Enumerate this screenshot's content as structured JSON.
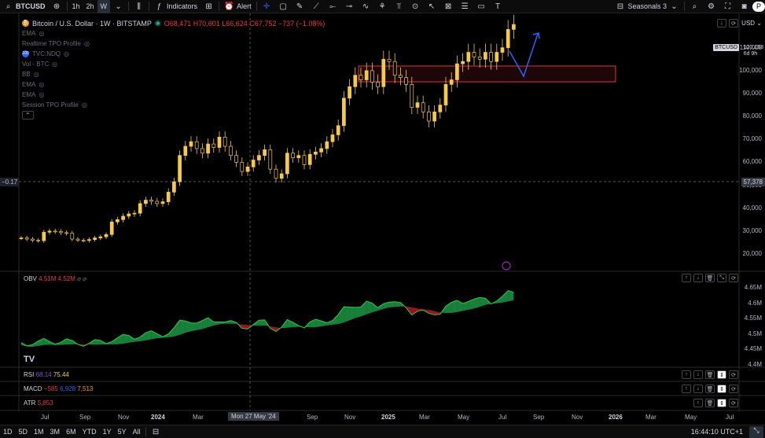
{
  "toolbar": {
    "symbol": "BTCUSD",
    "timeframes": [
      "1h",
      "2h",
      "W"
    ],
    "indicators_label": "Indicators",
    "alert_label": "Alert",
    "seasonals_label": "Seasonals 3",
    "right_letter": "P"
  },
  "legend": {
    "title": "Bitcoin / U.S. Dollar · 1W · BITSTAMP",
    "ohlc": "O68,471 H70,601 L66,624 C67,752 −737 (−1.08%)",
    "items": [
      "EMA",
      "Realtime TPO Profile",
      "TVC:NDQ",
      "Vol · BTC",
      "BB",
      "EMA",
      "EMA",
      "Session TPO Profile"
    ],
    "tvc_badge": "100"
  },
  "price_axis": {
    "labels": [
      "110,000",
      "100,000",
      "90,000",
      "80,000",
      "70,000",
      "60,000",
      "50,000",
      "40,000",
      "30,000",
      "20,000"
    ],
    "symbol_badge": "BTCUSD",
    "current_price": "120,168",
    "countdown": "6d 9h",
    "cursor_price": "57,378",
    "left_value": "−0.17"
  },
  "obv": {
    "name": "OBV",
    "values": "4.51M 4.52M",
    "axis": [
      "4.65M",
      "4.6M",
      "4.55M",
      "4.5M",
      "4.45M",
      "4.4M"
    ]
  },
  "rsi": {
    "name": "RSI",
    "v1": "68.14",
    "v2": "75.44"
  },
  "macd": {
    "name": "MACD",
    "v1": "−585",
    "v2": "6,928",
    "v3": "7,513"
  },
  "atr": {
    "name": "ATR",
    "v1": "5,853"
  },
  "time_axis": {
    "labels": [
      {
        "t": "Jul",
        "x": 52,
        "b": false
      },
      {
        "t": "Sep",
        "x": 101,
        "b": false
      },
      {
        "t": "Nov",
        "x": 150,
        "b": false
      },
      {
        "t": "2024",
        "x": 192,
        "b": true
      },
      {
        "t": "Mar",
        "x": 245,
        "b": false
      },
      {
        "t": "Sep",
        "x": 390,
        "b": false
      },
      {
        "t": "Nov",
        "x": 438,
        "b": false
      },
      {
        "t": "2025",
        "x": 485,
        "b": true
      },
      {
        "t": "Mar",
        "x": 533,
        "b": false
      },
      {
        "t": "May",
        "x": 582,
        "b": false
      },
      {
        "t": "Jul",
        "x": 634,
        "b": false
      },
      {
        "t": "Sep",
        "x": 678,
        "b": false
      },
      {
        "t": "Nov",
        "x": 727,
        "b": false
      },
      {
        "t": "2026",
        "x": 774,
        "b": true
      },
      {
        "t": "Mar",
        "x": 821,
        "b": false
      },
      {
        "t": "May",
        "x": 871,
        "b": false
      },
      {
        "t": "Jul",
        "x": 923,
        "b": false
      }
    ],
    "cursor_date": "Mon 27 May '24"
  },
  "bottom": {
    "ranges": [
      "1D",
      "5D",
      "1M",
      "3M",
      "6M",
      "YTD",
      "1Y",
      "5Y",
      "All"
    ],
    "clock": "16:44:10 UTC+1"
  },
  "chart_data": {
    "type": "candlestick",
    "series_name": "BTCUSD",
    "approx_weekly_closes": [
      27000,
      26500,
      26000,
      25800,
      29500,
      30000,
      29800,
      29300,
      29100,
      26500,
      26000,
      25900,
      26300,
      27000,
      27500,
      28500,
      34000,
      35000,
      36500,
      37500,
      37800,
      42000,
      43500,
      43000,
      42000,
      42800,
      47000,
      51500,
      63000,
      67000,
      69000,
      66000,
      64000,
      68000,
      66500,
      71000,
      67000,
      63000,
      60000,
      56000,
      58000,
      61000,
      63000,
      65500,
      57000,
      53000,
      55000,
      64000,
      62000,
      63000,
      59000,
      63500,
      64500,
      66000,
      69000,
      72000,
      76000,
      88000,
      93000,
      98000,
      96000,
      100000,
      95000,
      93000,
      105000,
      104000,
      98000,
      97000,
      94000,
      84000,
      86000,
      82000,
      78000,
      82000,
      85000,
      94000,
      96000,
      103000,
      104000,
      108000,
      106000,
      105000,
      108000,
      104000,
      108000,
      110000,
      118000,
      120168
    ],
    "ylim": [
      20000,
      125000
    ],
    "annotations": [
      "resistance zone ~104,000-111,000",
      "projected path arrow"
    ]
  }
}
